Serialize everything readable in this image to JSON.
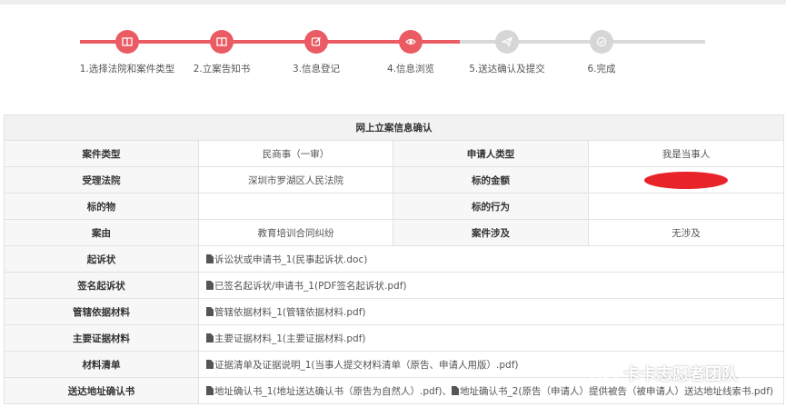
{
  "steps": [
    {
      "label": "1.选择法院和案件类型",
      "icon": "book-icon",
      "active": true
    },
    {
      "label": "2.立案告知书",
      "icon": "book-icon",
      "active": true
    },
    {
      "label": "3.信息登记",
      "icon": "edit-icon",
      "active": true
    },
    {
      "label": "4.信息浏览",
      "icon": "eye-icon",
      "active": true
    },
    {
      "label": "5.送达确认及提交",
      "icon": "send-icon",
      "active": false
    },
    {
      "label": "6.完成",
      "icon": "check-icon",
      "active": false
    }
  ],
  "colors": {
    "accent": "#ea5b63",
    "inactive": "#d6d6d6",
    "redaction": "#e8232a"
  },
  "table": {
    "title": "网上立案信息确认",
    "rows": {
      "case_type": {
        "label": "案件类型",
        "value": "民商事（一审）"
      },
      "applicant_type": {
        "label": "申请人类型",
        "value": "我是当事人"
      },
      "court": {
        "label": "受理法院",
        "value": "深圳市罗湖区人民法院"
      },
      "amount": {
        "label": "标的金额",
        "value": ""
      },
      "subject": {
        "label": "标的物",
        "value": ""
      },
      "subject_act": {
        "label": "标的行为",
        "value": ""
      },
      "cause": {
        "label": "案由",
        "value": "教育培训合同纠纷"
      },
      "involvement": {
        "label": "案件涉及",
        "value": "无涉及"
      }
    },
    "files": [
      {
        "label": "起诉状",
        "file": "诉讼状或申请书_1(民事起诉状.doc)"
      },
      {
        "label": "签名起诉状",
        "file": "已签名起诉状/申请书_1(PDF签名起诉状.pdf)"
      },
      {
        "label": "管辖依据材料",
        "file": "管辖依据材料_1(管辖依据材料.pdf)"
      },
      {
        "label": "主要证据材料",
        "file": "主要证据材料_1(主要证据材料.pdf)"
      },
      {
        "label": "材料清单",
        "file": "证据清单及证据说明_1(当事人提交材料清单（原告、申请人用版）.pdf)"
      },
      {
        "label": "送达地址确认书",
        "file": "地址确认书_1(地址送达确认书（原告为自然人）.pdf)、",
        "file2": "地址确认书_2(原告（申请人）提供被告（被申请人）送达地址线索书.pdf)"
      }
    ]
  },
  "watermark": {
    "text": "卡卡志愿者团队",
    "icon": "wechat-icon"
  }
}
